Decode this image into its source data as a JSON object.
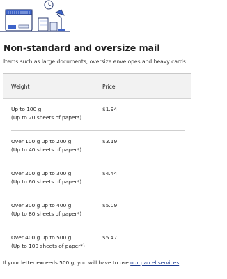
{
  "section": {
    "title": "Non-standard and oversize mail",
    "description": "Items such as large documents, oversize envelopes and heavy cards."
  },
  "table": {
    "headers": {
      "weight": "Weight",
      "price": "Price"
    },
    "rows": [
      {
        "weight": "Up to 100 g",
        "sheets": "(Up to 20 sheets of paper*)",
        "price": "$1.94"
      },
      {
        "weight": "Over 100 g up to 200 g",
        "sheets": "(Up to 40 sheets of paper*)",
        "price": "$3.19"
      },
      {
        "weight": "Over 200 g up to 300 g",
        "sheets": "(Up to 60 sheets of paper*)",
        "price": "$4.44"
      },
      {
        "weight": "Over 300 g up to 400 g",
        "sheets": "(Up to 80 sheets of paper*)",
        "price": "$5.09"
      },
      {
        "weight": "Over 400 g up to 500 g",
        "sheets": "(Up to 100 sheets of paper*)",
        "price": "$5.47"
      }
    ]
  },
  "footer": {
    "text": "If your letter exceeds 500 g, you will have to use ",
    "link": "our parcel services",
    "end": "."
  },
  "colors": {
    "accent_blue": "#3d63c9",
    "link": "#1a3a8f",
    "header_bg": "#f2f2f2"
  },
  "icons": [
    "mail-sorting-machine-illustration",
    "clock-icon",
    "desk-lamp-icon"
  ]
}
